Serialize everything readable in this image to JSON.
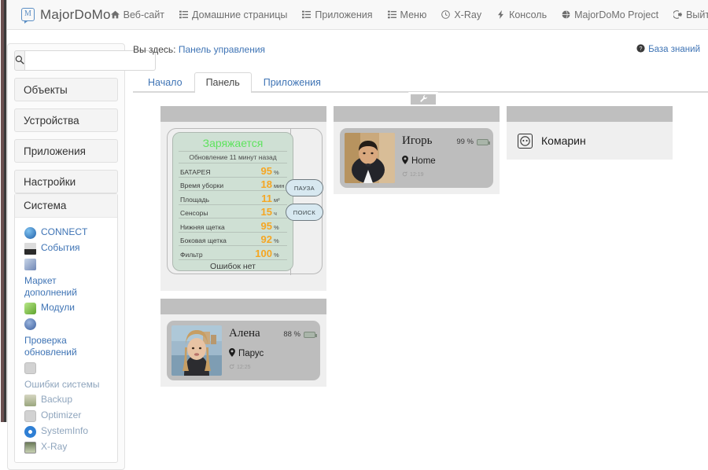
{
  "navbar": {
    "brand": {
      "mark": "M",
      "name": "MajorDoMo"
    },
    "links": [
      {
        "icon": "home-icon",
        "label": "Веб-сайт"
      },
      {
        "icon": "list-icon",
        "label": "Домашние страницы"
      },
      {
        "icon": "list-icon",
        "label": "Приложения"
      },
      {
        "icon": "list-icon",
        "label": "Меню"
      },
      {
        "icon": "clock-icon",
        "label": "X-Ray"
      },
      {
        "icon": "bolt-icon",
        "label": "Консоль"
      },
      {
        "icon": "globe-icon",
        "label": "MajorDoMo Project"
      },
      {
        "icon": "logout-icon",
        "label": "Выйти"
      }
    ]
  },
  "sidebar": {
    "search": {
      "icon": "search-icon",
      "value": "",
      "placeholder": ""
    },
    "buttons": [
      {
        "label": "Объекты"
      },
      {
        "label": "Устройства"
      },
      {
        "label": "Приложения"
      },
      {
        "label": "Настройки"
      }
    ],
    "group": {
      "title": "Система",
      "items": [
        {
          "label": "CONNECT",
          "icon": "globe-icon",
          "color": "#3f74b5",
          "muted": false
        },
        {
          "label": "События",
          "icon": "events-icon",
          "color": "#4a4a4a",
          "muted": false
        },
        {
          "label": "Маркет дополнений",
          "icon": "market-icon",
          "color": "#8fa5bd",
          "muted": false
        },
        {
          "label": "Модули",
          "icon": "puzzle-icon",
          "color": "#7ec24a",
          "muted": false
        },
        {
          "label": "Проверка обновлений",
          "icon": "update-icon",
          "color": "#6f86b5",
          "muted": false
        },
        {
          "label": "Ошибки системы",
          "icon": "warning-icon",
          "color": "#b8b8b8",
          "muted": true
        },
        {
          "label": "Backup",
          "icon": "backup-icon",
          "color": "#9aa67e",
          "muted": true
        },
        {
          "label": "Optimizer",
          "icon": "optimizer-icon",
          "color": "#b8b8b8",
          "muted": true
        },
        {
          "label": "SystemInfo",
          "icon": "info-icon",
          "color": "#2f7fd4",
          "muted": true
        },
        {
          "label": "X-Ray",
          "icon": "xray-icon",
          "color": "#7d8a6b",
          "muted": true
        }
      ]
    }
  },
  "content": {
    "breadcrumb_prefix": "Вы здесь:",
    "breadcrumb_current": "Панель управления",
    "knowledge_base": {
      "icon": "help-icon",
      "label": "База знаний"
    },
    "tabs": [
      {
        "label": "Начало",
        "active": false
      },
      {
        "label": "Панель",
        "active": true
      },
      {
        "label": "Приложения",
        "active": false
      }
    ],
    "wrench_button": {
      "icon": "wrench-icon",
      "label": ""
    }
  },
  "dashboard": {
    "vacuum": {
      "status": "Заряжается",
      "status_color": "#5ee35e",
      "subtitle": "Обновление 11 минут назад",
      "rows": [
        {
          "key": "БАТАРЕЯ",
          "value": "95",
          "unit": "%"
        },
        {
          "key": "Время уборки",
          "value": "18",
          "unit": "мин"
        },
        {
          "key": "Площадь",
          "value": "11",
          "unit": "м²"
        },
        {
          "key": "Сенсоры",
          "value": "15",
          "unit": "ч"
        },
        {
          "key": "Нижняя щетка",
          "value": "95",
          "unit": "%"
        },
        {
          "key": "Боковая щетка",
          "value": "92",
          "unit": "%"
        },
        {
          "key": "Фильтр",
          "value": "100",
          "unit": "%"
        }
      ],
      "footer": "Ошибок нет",
      "buttons": [
        {
          "label": "ПАУЗА"
        },
        {
          "label": "ПОИСК"
        }
      ]
    },
    "igor": {
      "name": "Игорь",
      "battery_pct": "99 %",
      "battery_level": 99,
      "location_icon": "pin-icon",
      "location": "Home",
      "time_icon": "refresh-icon",
      "time": "12:19"
    },
    "alena": {
      "name": "Алена",
      "battery_pct": "88 %",
      "battery_level": 88,
      "location_icon": "pin-icon",
      "location": "Парус",
      "time_icon": "refresh-icon",
      "time": "12:25"
    },
    "komarin": {
      "icon": "socket-icon",
      "label": "Комарин"
    }
  },
  "colors": {
    "accent_link": "#3f74b5",
    "panel_header": "#bfbfbf",
    "panel_body": "#efefef",
    "vacuum_card": "#cfe0d4",
    "value_orange": "#f5a623",
    "battery_green": "#5ee35e"
  }
}
